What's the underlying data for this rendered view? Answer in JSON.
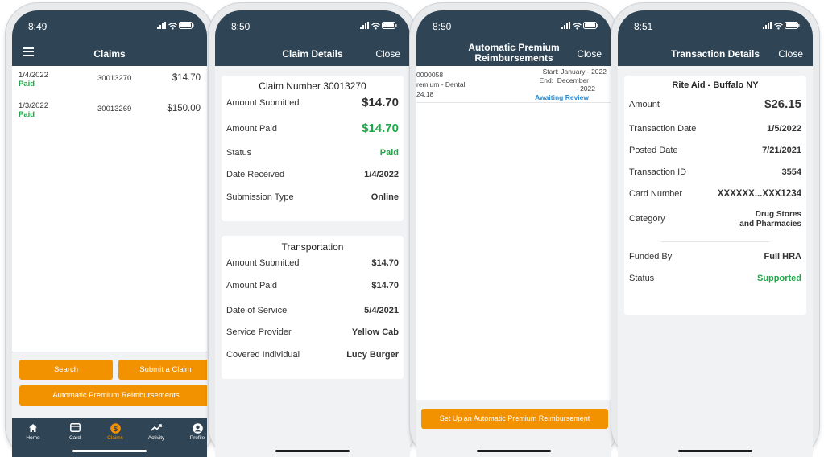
{
  "colors": {
    "header": "#2f4556",
    "accent": "#f39200",
    "paid_green": "#1fa847",
    "link_blue": "#2b8fd8"
  },
  "screen1": {
    "time": "8:49",
    "title": "Claims",
    "claims": [
      {
        "date": "1/4/2022",
        "status": "Paid",
        "number": "30013270",
        "amount": "$14.70"
      },
      {
        "date": "1/3/2022",
        "status": "Paid",
        "number": "30013269",
        "amount": "$150.00"
      }
    ],
    "search_label": "Search",
    "submit_label": "Submit a Claim",
    "auto_label": "Automatic Premium Reimbursements",
    "tabs": {
      "home": "Home",
      "card": "Card",
      "claims": "Claims",
      "activity": "Activity",
      "profile": "Profile"
    }
  },
  "screen2": {
    "time": "8:50",
    "title": "Claim Details",
    "close_label": "Close",
    "claim_title_label": "Claim Number",
    "claim_number": "30013270",
    "rows": [
      {
        "label": "Amount Submitted",
        "value": "$14.70"
      },
      {
        "label": "Amount Paid",
        "value": "$14.70"
      },
      {
        "label": "Status",
        "value": "Paid"
      },
      {
        "label": "Date Received",
        "value": "1/4/2022"
      },
      {
        "label": "Submission Type",
        "value": "Online"
      }
    ],
    "transport_title": "Transportation",
    "transport_rows": [
      {
        "label": "Amount Submitted",
        "value": "$14.70"
      },
      {
        "label": "Amount Paid",
        "value": "$14.70"
      },
      {
        "label": "Date of Service",
        "value": "5/4/2021"
      },
      {
        "label": "Service Provider",
        "value": "Yellow Cab"
      },
      {
        "label": "Covered Individual",
        "value": "Lucy Burger"
      }
    ]
  },
  "screen3": {
    "time": "8:50",
    "title_line1": "Automatic Premium",
    "title_line2": "Reimbursements",
    "close_label": "Close",
    "item": {
      "id": "0000058",
      "type": "remium - Dental",
      "amount": "24.18",
      "start": "Start: January - 2022",
      "end_label": "End:",
      "end_month": "December",
      "end_year": "- 2022",
      "status": "Awaiting Review"
    },
    "setup_label": "Set Up an Automatic Premium Reimbursement"
  },
  "screen4": {
    "time": "8:51",
    "title": "Transaction Details",
    "close_label": "Close",
    "merchant": "Rite Aid - Buffalo NY",
    "rows": [
      {
        "label": "Amount",
        "value": "$26.15"
      },
      {
        "label": "Transaction Date",
        "value": "1/5/2022"
      },
      {
        "label": "Posted Date",
        "value": "7/21/2021"
      },
      {
        "label": "Transaction ID",
        "value": "3554"
      },
      {
        "label": "Card Number",
        "value": "XXXXXX...XXX1234"
      },
      {
        "label": "Category",
        "value_line1": "Drug Stores",
        "value_line2": "and Pharmacies"
      },
      {
        "label": "Funded By",
        "value": "Full HRA"
      },
      {
        "label": "Status",
        "value": "Supported"
      }
    ]
  }
}
